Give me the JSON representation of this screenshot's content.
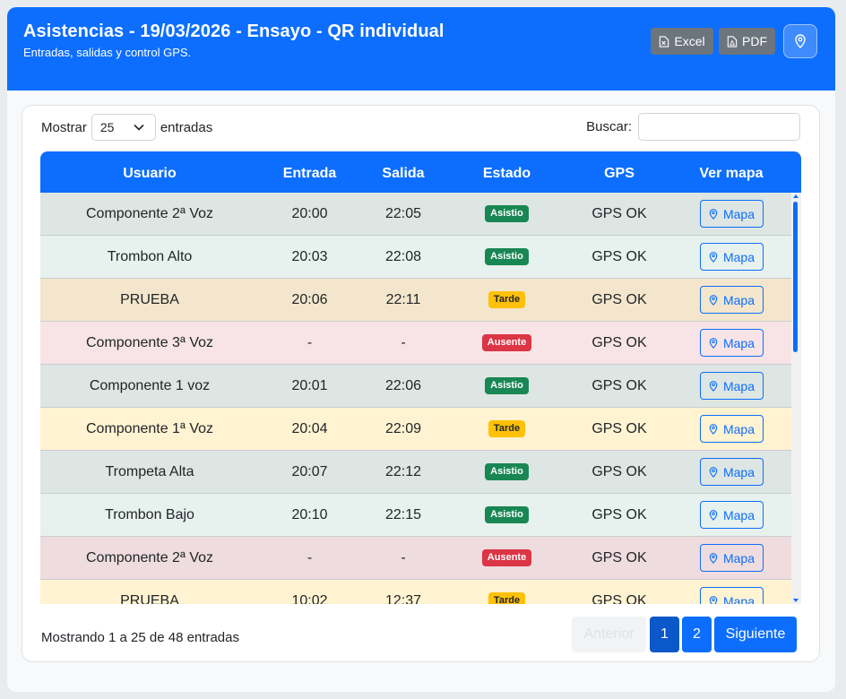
{
  "header": {
    "title": "Asistencias - 19/03/2026 - Ensayo - QR individual",
    "subtitle": "Entradas, salidas y control GPS.",
    "excel_label": "Excel",
    "pdf_label": "PDF"
  },
  "controls": {
    "show_label": "Mostrar",
    "page_size": "25",
    "entries_label": "entradas",
    "search_label": "Buscar:",
    "search_value": ""
  },
  "table": {
    "headers": [
      "Usuario",
      "Entrada",
      "Salida",
      "Estado",
      "GPS",
      "Ver mapa"
    ],
    "rows": [
      {
        "usuario": "Componente 2ª Voz",
        "entrada": "20:00",
        "salida": "22:05",
        "estado": "Asistio",
        "gps": "GPS OK",
        "mapa": "Mapa"
      },
      {
        "usuario": "Trombon Alto",
        "entrada": "20:03",
        "salida": "22:08",
        "estado": "Asistio",
        "gps": "GPS OK",
        "mapa": "Mapa"
      },
      {
        "usuario": "PRUEBA",
        "entrada": "20:06",
        "salida": "22:11",
        "estado": "Tarde",
        "gps": "GPS OK",
        "mapa": "Mapa"
      },
      {
        "usuario": "Componente 3ª Voz",
        "entrada": "-",
        "salida": "-",
        "estado": "Ausente",
        "gps": "GPS OK",
        "mapa": "Mapa"
      },
      {
        "usuario": "Componente 1 voz",
        "entrada": "20:01",
        "salida": "22:06",
        "estado": "Asistio",
        "gps": "GPS OK",
        "mapa": "Mapa"
      },
      {
        "usuario": "Componente 1ª Voz",
        "entrada": "20:04",
        "salida": "22:09",
        "estado": "Tarde",
        "gps": "GPS OK",
        "mapa": "Mapa"
      },
      {
        "usuario": "Trompeta Alta",
        "entrada": "20:07",
        "salida": "22:12",
        "estado": "Asistio",
        "gps": "GPS OK",
        "mapa": "Mapa"
      },
      {
        "usuario": "Trombon Bajo",
        "entrada": "20:10",
        "salida": "22:15",
        "estado": "Asistio",
        "gps": "GPS OK",
        "mapa": "Mapa"
      },
      {
        "usuario": "Componente 2ª Voz",
        "entrada": "-",
        "salida": "-",
        "estado": "Ausente",
        "gps": "GPS OK",
        "mapa": "Mapa"
      },
      {
        "usuario": "PRUEBA",
        "entrada": "10:02",
        "salida": "12:37",
        "estado": "Tarde",
        "gps": "GPS OK",
        "mapa": "Mapa"
      }
    ]
  },
  "colors": {
    "primary": "#0d6efd",
    "row_asistio_a": "#dde6e2",
    "row_asistio_b": "#e7f1ed",
    "row_tarde_a": "#f3e6cc",
    "row_tarde_b": "#fff3d1",
    "row_ausente_a": "#f8e4e6",
    "row_ausente_b": "#eedcde",
    "badge_asistio": "#198754",
    "badge_tarde": "#ffc107",
    "badge_ausente": "#dc3545"
  },
  "footer": {
    "info": "Mostrando 1 a 25 de 48 entradas",
    "prev_label": "Anterior",
    "page1": "1",
    "page2": "2",
    "next_label": "Siguiente"
  }
}
